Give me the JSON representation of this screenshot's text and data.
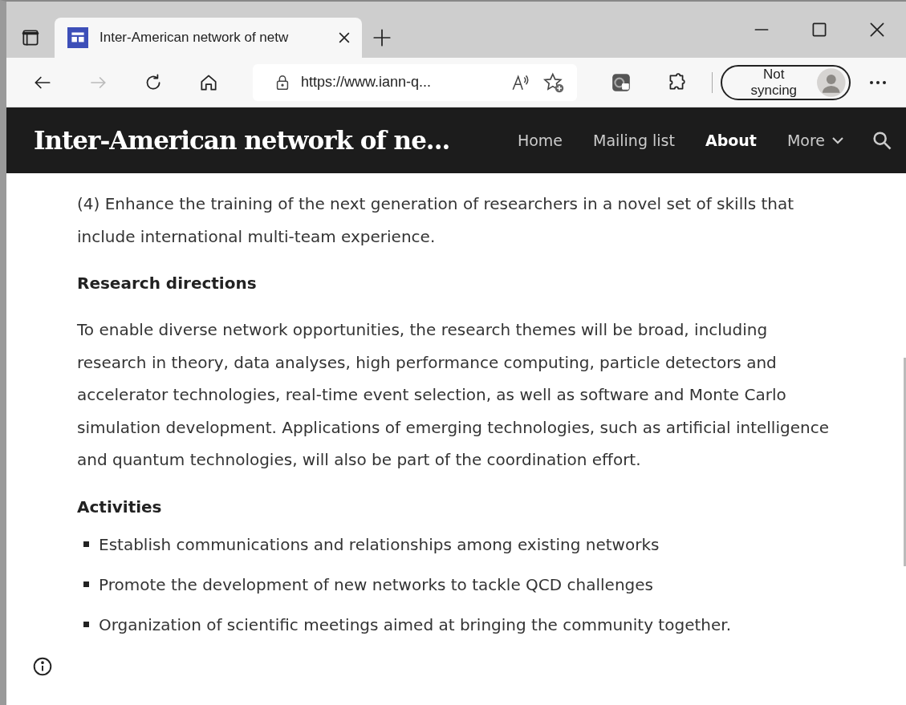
{
  "browser": {
    "tab": {
      "title": "Inter-American network of netw"
    },
    "address": "https://www.iann-q...",
    "sync": "Not syncing"
  },
  "site": {
    "title": "Inter-American network of ne...",
    "nav": [
      {
        "label": "Home",
        "selected": false
      },
      {
        "label": "Mailing list",
        "selected": false
      },
      {
        "label": "About",
        "selected": true
      },
      {
        "label": "More",
        "selected": false
      }
    ]
  },
  "content": {
    "blocks": [
      {
        "kind": "paragraph",
        "text": "(4) Enhance the training of the next generation of researchers in a novel set of skills that include international multi-team experience."
      },
      {
        "kind": "heading",
        "text": "Research directions"
      },
      {
        "kind": "paragraph",
        "text": "To enable diverse network opportunities, the research themes will be broad, including research in theory, data analyses, high performance computing, particle detectors and accelerator technologies, real-time event selection, as well as software and Monte Carlo simulation development. Applications of emerging technologies, such as artificial intelligence and quantum technologies, will also be part of the coordination effort."
      },
      {
        "kind": "heading",
        "text": "Activities"
      },
      {
        "kind": "list",
        "items": [
          "Establish communications and relationships among existing networks",
          "Promote the development of new networks to tackle QCD challenges",
          "Organization of scientific meetings aimed at bringing the community together."
        ]
      }
    ]
  }
}
